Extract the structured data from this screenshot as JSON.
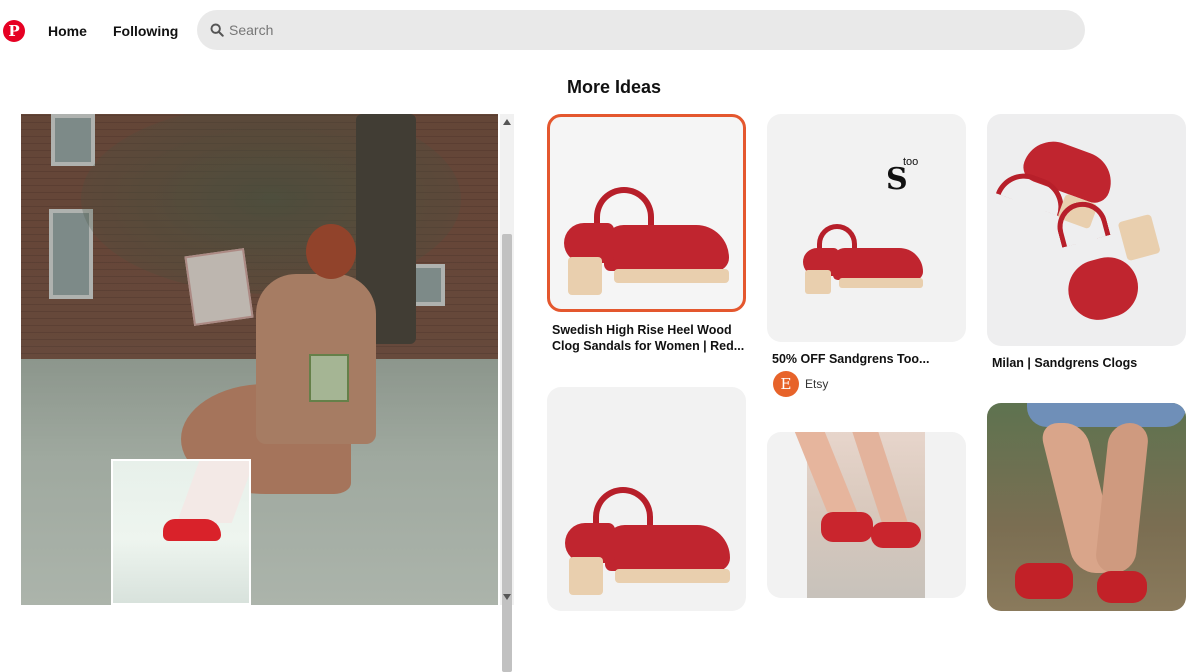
{
  "header": {
    "logo_letter": "P",
    "nav": {
      "home": "Home",
      "following": "Following"
    },
    "search": {
      "placeholder": "Search",
      "value": ""
    }
  },
  "main": {
    "section_title": "More Ideas"
  },
  "pins": [
    {
      "title_line1": "Swedish High Rise Heel Wood",
      "title_line2": "Clog Sandals for Women | Red..."
    },
    {
      "title": "50% OFF Sandgrens Too...",
      "source_initial": "E",
      "source_name": "Etsy",
      "brand_mark": "S",
      "brand_word": "too"
    },
    {
      "title": "Milan | Sandgrens Clogs"
    }
  ],
  "colors": {
    "brand": "#e60023",
    "selected_border": "#e4572e",
    "etsy": "#e7632a"
  },
  "icons": {
    "logo": "pinterest-logo",
    "search": "search-icon",
    "scroll_up": "scroll-up-arrow",
    "scroll_down": "scroll-down-arrow"
  }
}
